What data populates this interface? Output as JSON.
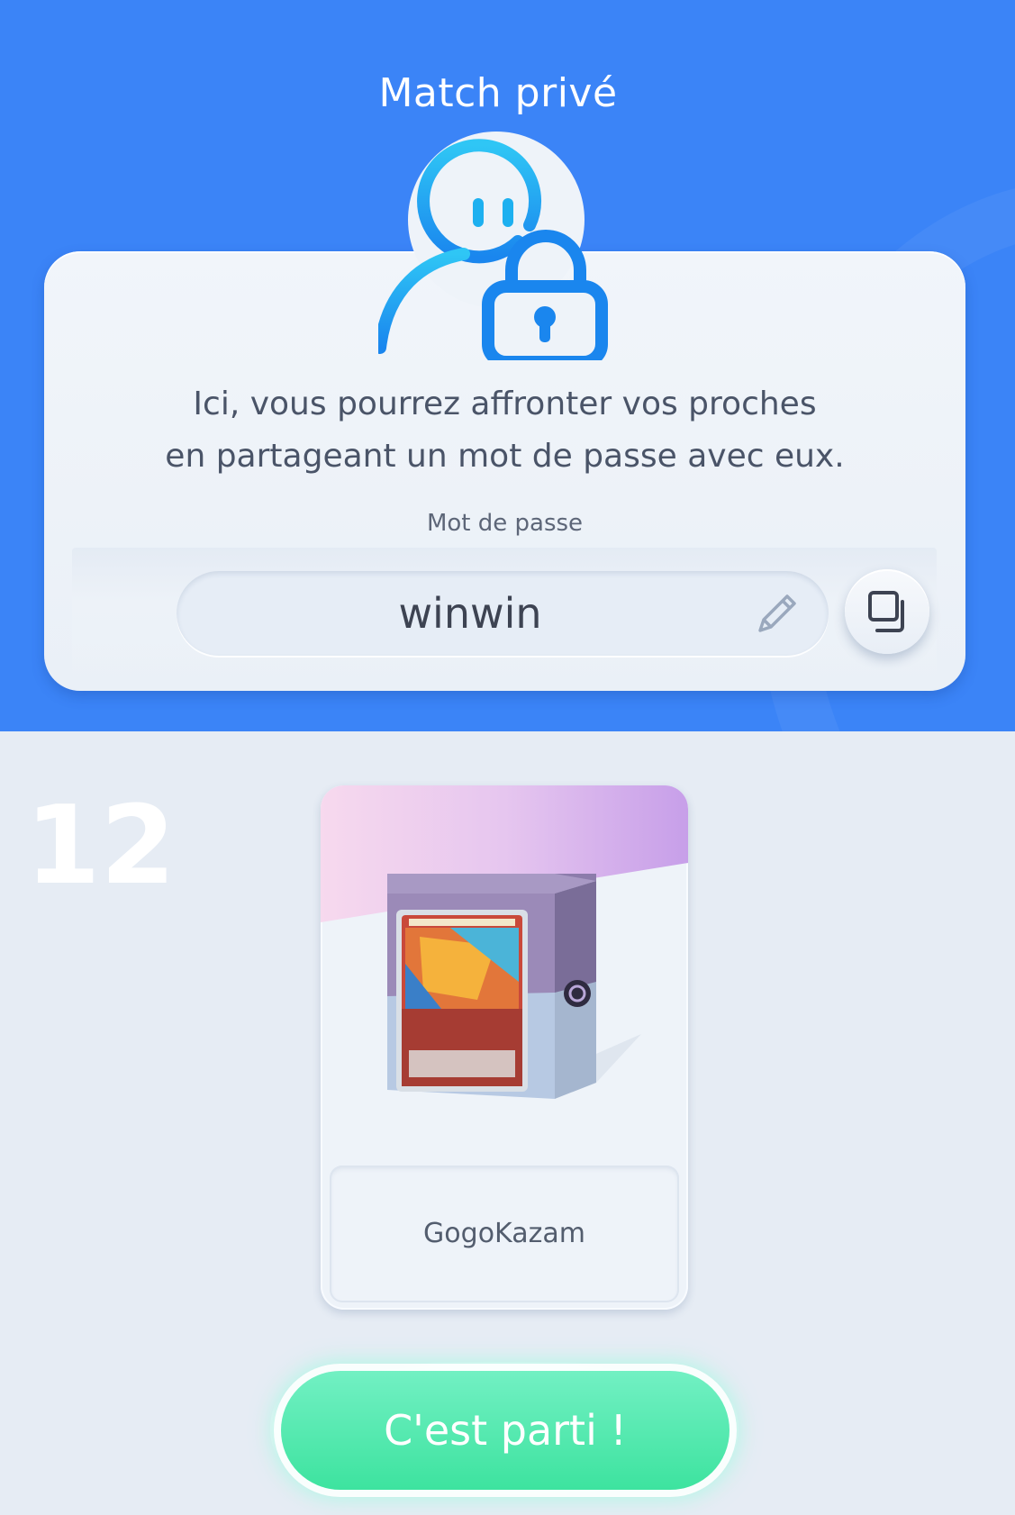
{
  "header": {
    "title": "Match privé"
  },
  "panel": {
    "description_line1": "Ici, vous pourrez affronter vos proches",
    "description_line2": "en partageant un mot de passe avec eux.",
    "password_label": "Mot de passe",
    "password_value": "winwin",
    "edit_icon": "pencil-icon",
    "copy_icon": "copy-icon",
    "mascot_icon": "locked-player-icon"
  },
  "deck": {
    "count": "12",
    "name": "GogoKazam",
    "box_icon": "deck-box-icon"
  },
  "actions": {
    "start_label": "C'est parti !"
  },
  "colors": {
    "header_bg": "#3b84f7",
    "icon_blue": "#1fb0f0",
    "start_green": "#4ae6ab",
    "deck_purple": "#c9a3ea"
  }
}
